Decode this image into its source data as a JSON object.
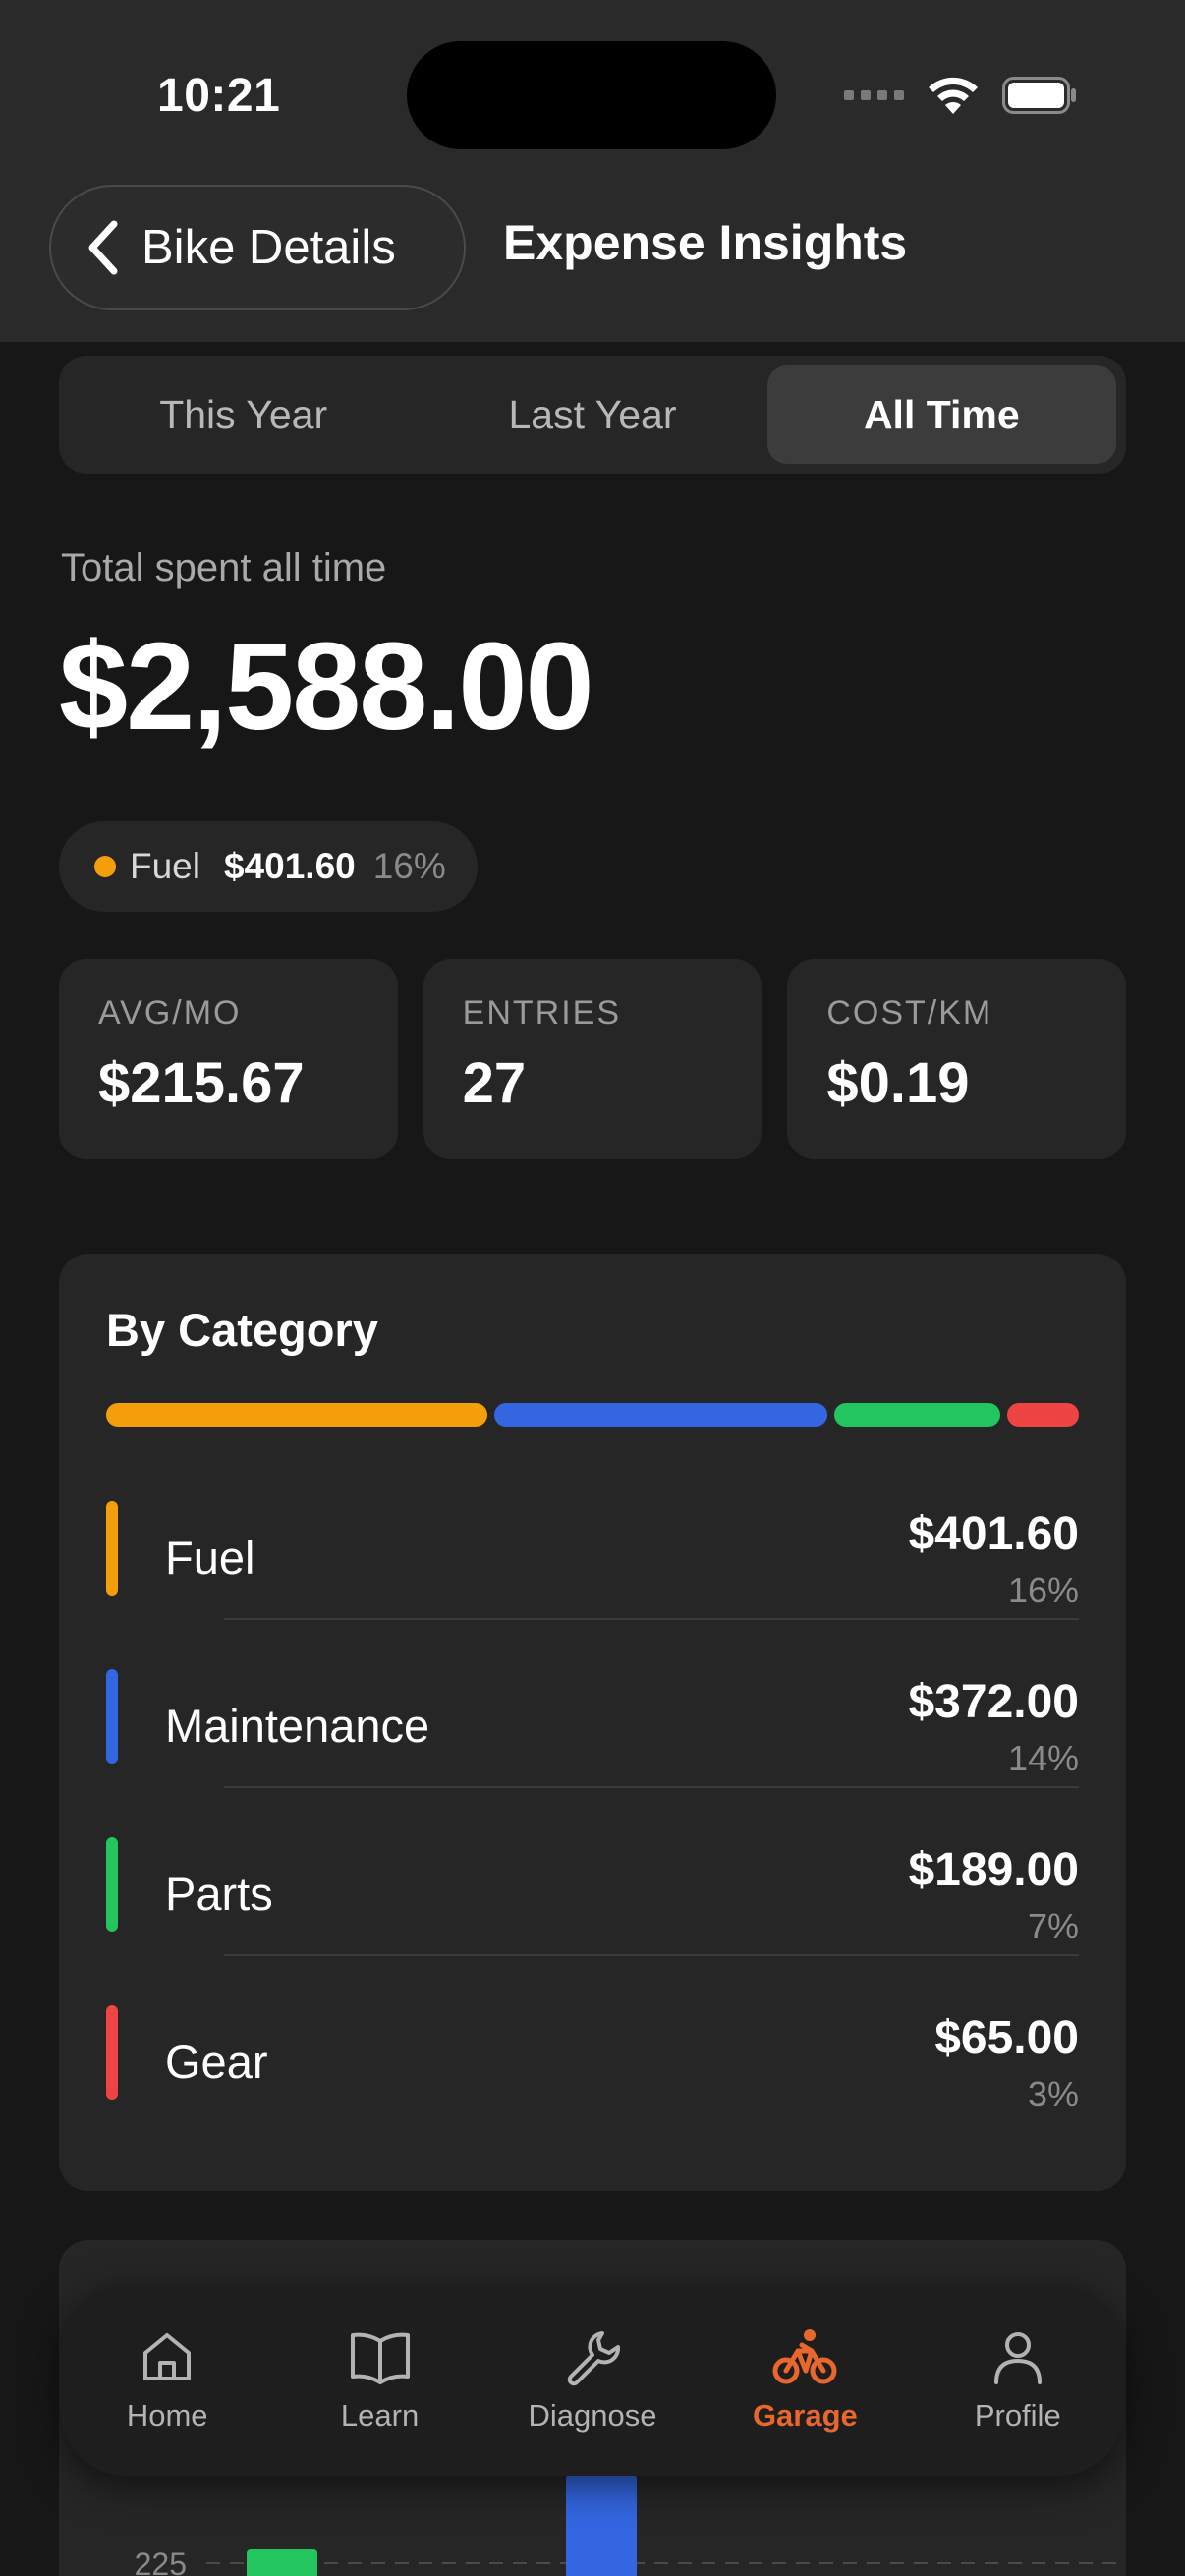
{
  "status": {
    "time": "10:21"
  },
  "header": {
    "back_label": "Bike Details",
    "title": "Expense Insights"
  },
  "segments": [
    {
      "label": "This Year",
      "active": false
    },
    {
      "label": "Last Year",
      "active": false
    },
    {
      "label": "All Time",
      "active": true
    }
  ],
  "total": {
    "caption": "Total spent all time",
    "amount": "$2,588.00"
  },
  "chip": {
    "label": "Fuel",
    "amount": "$401.60",
    "percent": "16%",
    "color": "#f59e0b"
  },
  "stats": [
    {
      "label": "AVG/MO",
      "value": "$215.67"
    },
    {
      "label": "ENTRIES",
      "value": "27"
    },
    {
      "label": "COST/KM",
      "value": "$0.19"
    }
  ],
  "categories": {
    "title": "By Category",
    "items": [
      {
        "name": "Fuel",
        "amount": "$401.60",
        "percent": "16%",
        "share": 0.16,
        "color": "#f59e0b"
      },
      {
        "name": "Maintenance",
        "amount": "$372.00",
        "percent": "14%",
        "share": 0.14,
        "color": "#3366e0"
      },
      {
        "name": "Parts",
        "amount": "$189.00",
        "percent": "7%",
        "share": 0.07,
        "color": "#22c55e"
      },
      {
        "name": "Gear",
        "amount": "$65.00",
        "percent": "3%",
        "share": 0.03,
        "color": "#ef4444"
      }
    ]
  },
  "chart": {
    "visible_tick": "225"
  },
  "tabbar": {
    "active_color": "#e8672f",
    "items": [
      {
        "label": "Home",
        "icon": "home-icon",
        "active": false
      },
      {
        "label": "Learn",
        "icon": "book-icon",
        "active": false
      },
      {
        "label": "Diagnose",
        "icon": "wrench-icon",
        "active": false
      },
      {
        "label": "Garage",
        "icon": "bicycle-icon",
        "active": true
      },
      {
        "label": "Profile",
        "icon": "person-icon",
        "active": false
      }
    ]
  }
}
